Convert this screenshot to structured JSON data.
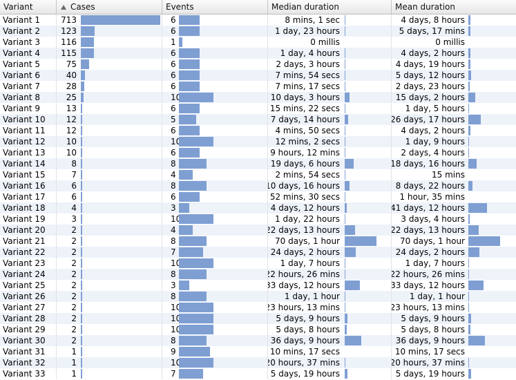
{
  "columns": {
    "variant": "Variant",
    "cases": "Cases",
    "events": "Events",
    "median": "Median duration",
    "mean": "Mean duration"
  },
  "sort": {
    "column": "cases",
    "direction": "ascending-indicator",
    "icon": "sort-up-triangle-icon"
  },
  "colors": {
    "bar": "#7f9fd3",
    "alt_row": "#eef3fa",
    "header": "#ececec"
  },
  "rows": [
    {
      "variant": "Variant 1",
      "cases": 713,
      "events": 6,
      "median": "8 mins, 1 sec",
      "median_frac": 0.002,
      "mean": "4 days, 8 hours",
      "mean_frac": 0.062
    },
    {
      "variant": "Variant 2",
      "cases": 123,
      "events": 6,
      "median": "1 day, 23 hours",
      "median_frac": 0.028,
      "mean": "5 days, 17 mins",
      "mean_frac": 0.071
    },
    {
      "variant": "Variant 3",
      "cases": 116,
      "events": 1,
      "median": "0 millis",
      "median_frac": 0.0,
      "mean": "0 millis",
      "mean_frac": 0.0
    },
    {
      "variant": "Variant 4",
      "cases": 115,
      "events": 6,
      "median": "1 day, 4 hours",
      "median_frac": 0.017,
      "mean": "4 days, 2 hours",
      "mean_frac": 0.058
    },
    {
      "variant": "Variant 5",
      "cases": 75,
      "events": 6,
      "median": "2 days, 3 hours",
      "median_frac": 0.03,
      "mean": "4 days, 19 hours",
      "mean_frac": 0.068
    },
    {
      "variant": "Variant 6",
      "cases": 40,
      "events": 6,
      "median": "7 mins, 54 secs",
      "median_frac": 0.002,
      "mean": "5 days, 12 hours",
      "mean_frac": 0.078
    },
    {
      "variant": "Variant 7",
      "cases": 28,
      "events": 6,
      "median": "7 mins, 17 secs",
      "median_frac": 0.002,
      "mean": "2 days, 23 hours",
      "mean_frac": 0.042
    },
    {
      "variant": "Variant 8",
      "cases": 25,
      "events": 10,
      "median": "10 days, 3 hours",
      "median_frac": 0.144,
      "mean": "15 days, 2 hours",
      "mean_frac": 0.215
    },
    {
      "variant": "Variant 9",
      "cases": 13,
      "events": 6,
      "median": "15 mins, 22 secs",
      "median_frac": 0.002,
      "mean": "1 day, 5 hours",
      "mean_frac": 0.017
    },
    {
      "variant": "Variant 10",
      "cases": 12,
      "events": 5,
      "median": "7 days, 14 hours",
      "median_frac": 0.108,
      "mean": "26 days, 17 hours",
      "mean_frac": 0.381
    },
    {
      "variant": "Variant 11",
      "cases": 12,
      "events": 6,
      "median": "4 mins, 50 secs",
      "median_frac": 0.002,
      "mean": "4 days, 2 hours",
      "mean_frac": 0.058
    },
    {
      "variant": "Variant 12",
      "cases": 10,
      "events": 10,
      "median": "12 mins, 2 secs",
      "median_frac": 0.002,
      "mean": "1 day, 9 hours",
      "mean_frac": 0.02
    },
    {
      "variant": "Variant 13",
      "cases": 10,
      "events": 6,
      "median": "9 hours, 12 mins",
      "median_frac": 0.005,
      "mean": "2 days, 4 hours",
      "mean_frac": 0.031
    },
    {
      "variant": "Variant 14",
      "cases": 8,
      "events": 8,
      "median": "19 days, 6 hours",
      "median_frac": 0.275,
      "mean": "18 days, 16 hours",
      "mean_frac": 0.266
    },
    {
      "variant": "Variant 15",
      "cases": 7,
      "events": 4,
      "median": "2 mins, 54 secs",
      "median_frac": 0.001,
      "mean": "15 mins",
      "mean_frac": 0.0
    },
    {
      "variant": "Variant 16",
      "cases": 6,
      "events": 8,
      "median": "10 days, 16 hours",
      "median_frac": 0.152,
      "mean": "8 days, 22 hours",
      "mean_frac": 0.127
    },
    {
      "variant": "Variant 17",
      "cases": 6,
      "events": 6,
      "median": "52 mins, 30 secs",
      "median_frac": 0.002,
      "mean": "1 hour, 35 mins",
      "mean_frac": 0.0
    },
    {
      "variant": "Variant 18",
      "cases": 4,
      "events": 3,
      "median": "4 days, 12 hours",
      "median_frac": 0.064,
      "mean": "41 days, 12 hours",
      "mean_frac": 0.592
    },
    {
      "variant": "Variant 19",
      "cases": 3,
      "events": 10,
      "median": "1 day, 22 hours",
      "median_frac": 0.027,
      "mean": "3 days, 4 hours",
      "mean_frac": 0.045
    },
    {
      "variant": "Variant 20",
      "cases": 2,
      "events": 4,
      "median": "22 days, 13 hours",
      "median_frac": 0.322,
      "mean": "22 days, 13 hours",
      "mean_frac": 0.322
    },
    {
      "variant": "Variant 21",
      "cases": 2,
      "events": 8,
      "median": "70 days, 1 hour",
      "median_frac": 1.0,
      "mean": "70 days, 1 hour",
      "mean_frac": 1.0
    },
    {
      "variant": "Variant 22",
      "cases": 2,
      "events": 7,
      "median": "24 days, 2 hours",
      "median_frac": 0.344,
      "mean": "24 days, 2 hours",
      "mean_frac": 0.344
    },
    {
      "variant": "Variant 23",
      "cases": 2,
      "events": 10,
      "median": "1 day, 7 hours",
      "median_frac": 0.018,
      "mean": "1 day, 7 hours",
      "mean_frac": 0.018
    },
    {
      "variant": "Variant 24",
      "cases": 2,
      "events": 8,
      "median": "22 hours, 26 mins",
      "median_frac": 0.013,
      "mean": "22 hours, 26 mins",
      "mean_frac": 0.013
    },
    {
      "variant": "Variant 25",
      "cases": 2,
      "events": 3,
      "median": "33 days, 12 hours",
      "median_frac": 0.478,
      "mean": "33 days, 12 hours",
      "mean_frac": 0.478
    },
    {
      "variant": "Variant 26",
      "cases": 2,
      "events": 8,
      "median": "1 day, 1 hour",
      "median_frac": 0.015,
      "mean": "1 day, 1 hour",
      "mean_frac": 0.015
    },
    {
      "variant": "Variant 27",
      "cases": 2,
      "events": 10,
      "median": "23 hours, 13 mins",
      "median_frac": 0.014,
      "mean": "23 hours, 13 mins",
      "mean_frac": 0.014
    },
    {
      "variant": "Variant 28",
      "cases": 2,
      "events": 10,
      "median": "5 days, 9 hours",
      "median_frac": 0.077,
      "mean": "5 days, 9 hours",
      "mean_frac": 0.077
    },
    {
      "variant": "Variant 29",
      "cases": 2,
      "events": 10,
      "median": "5 days, 8 hours",
      "median_frac": 0.076,
      "mean": "5 days, 8 hours",
      "mean_frac": 0.076
    },
    {
      "variant": "Variant 30",
      "cases": 2,
      "events": 8,
      "median": "36 days, 9 hours",
      "median_frac": 0.519,
      "mean": "36 days, 9 hours",
      "mean_frac": 0.519
    },
    {
      "variant": "Variant 31",
      "cases": 1,
      "events": 9,
      "median": "10 mins, 17 secs",
      "median_frac": 0.0,
      "mean": "10 mins, 17 secs",
      "mean_frac": 0.0
    },
    {
      "variant": "Variant 32",
      "cases": 1,
      "events": 10,
      "median": "20 hours, 37 mins",
      "median_frac": 0.012,
      "mean": "20 hours, 37 mins",
      "mean_frac": 0.012
    },
    {
      "variant": "Variant 33",
      "cases": 1,
      "events": 7,
      "median": "5 days, 19 hours",
      "median_frac": 0.083,
      "mean": "5 days, 19 hours",
      "mean_frac": 0.083
    }
  ]
}
